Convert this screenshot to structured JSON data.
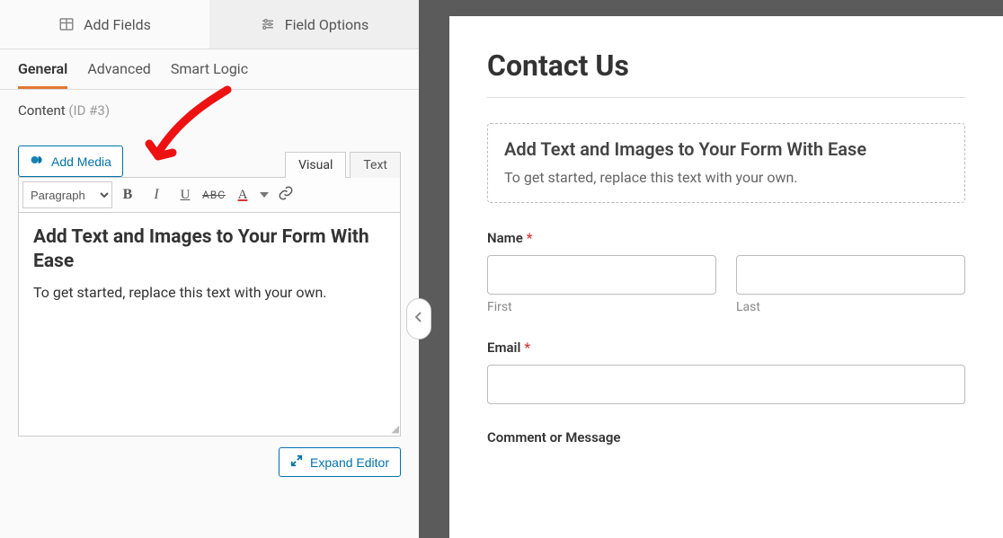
{
  "left": {
    "topTabs": {
      "addFields": "Add Fields",
      "fieldOptions": "Field Options"
    },
    "subTabs": {
      "general": "General",
      "advanced": "Advanced",
      "smartLogic": "Smart Logic"
    },
    "content": {
      "label": "Content",
      "idText": "(ID #3)"
    },
    "addMedia": "Add Media",
    "editorTabs": {
      "visual": "Visual",
      "text": "Text"
    },
    "format": {
      "paragraph": "Paragraph"
    },
    "editor": {
      "heading": "Add Text and Images to Your Form With Ease",
      "body": "To get started, replace this text with your own."
    },
    "expand": "Expand Editor"
  },
  "preview": {
    "title": "Contact Us",
    "contentBlock": {
      "heading": "Add Text and Images to Your Form With Ease",
      "body": "To get started, replace this text with your own."
    },
    "fields": {
      "name": {
        "label": "Name",
        "first": "First",
        "last": "Last"
      },
      "email": {
        "label": "Email"
      },
      "comment": {
        "label": "Comment or Message"
      }
    },
    "asterisk": "*"
  }
}
